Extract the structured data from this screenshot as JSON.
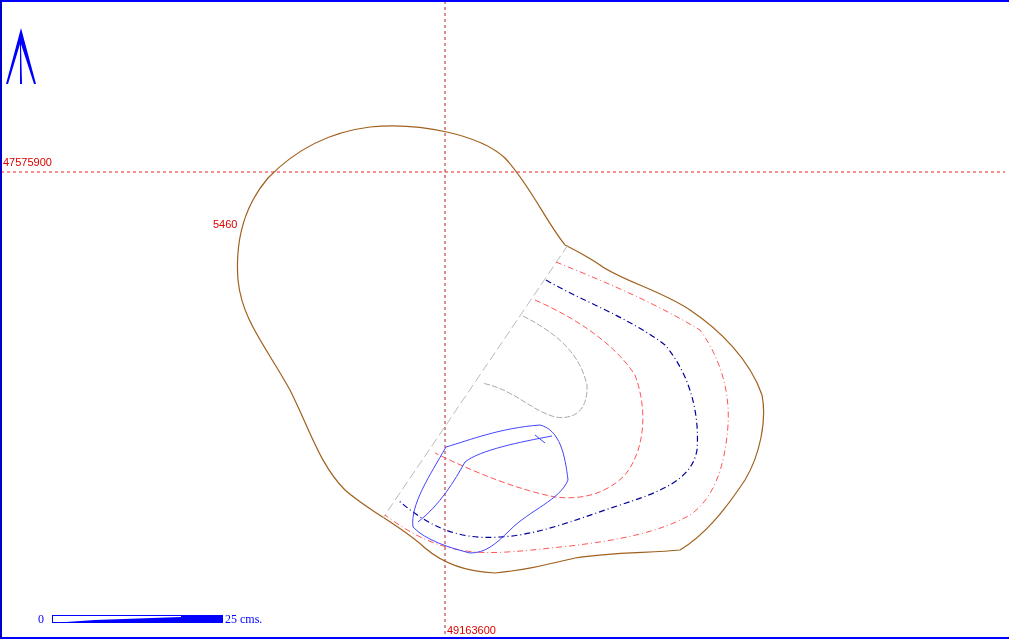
{
  "map": {
    "grid_lines": [
      {
        "kind": "horizontal",
        "label": "47575900"
      },
      {
        "kind": "vertical",
        "label": "49163600"
      }
    ],
    "contour_label": "5460",
    "scale_bar": {
      "start_label": "0",
      "end_label": "25 cms."
    }
  }
}
